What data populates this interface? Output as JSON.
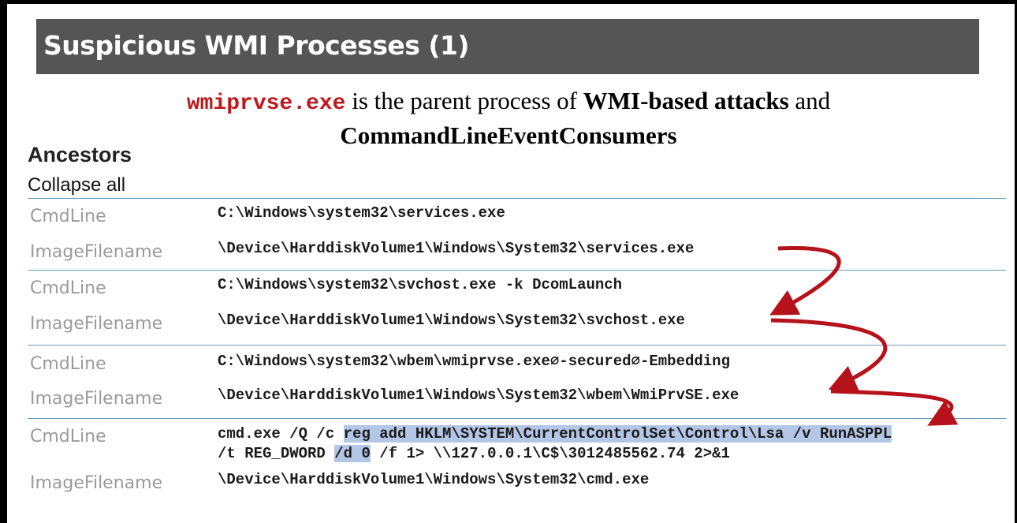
{
  "title": "Suspicious WMI Processes (1)",
  "intro": {
    "code": "wmiprvse.exe",
    "text1": " is the parent process of ",
    "bold1": "WMI-based attacks",
    "text2": " and",
    "bold2": "CommandLineEventConsumers"
  },
  "panel": {
    "heading": "Ancestors",
    "collapse_label": "Collapse all",
    "labels": {
      "cmdline": "CmdLine",
      "image": "ImageFilename"
    },
    "rows": [
      {
        "cmdline": "C:\\Windows\\system32\\services.exe",
        "image": "\\Device\\HarddiskVolume1\\Windows\\System32\\services.exe"
      },
      {
        "cmdline": "C:\\Windows\\system32\\svchost.exe -k DcomLaunch",
        "image": "\\Device\\HarddiskVolume1\\Windows\\System32\\svchost.exe"
      },
      {
        "cmdline": "C:\\Windows\\system32\\wbem\\wmiprvse.exe∅-secured∅-Embedding",
        "image": "\\Device\\HarddiskVolume1\\Windows\\System32\\wbem\\WmiPrvSE.exe"
      },
      {
        "cmdline_prefix": "cmd.exe /Q /c ",
        "cmdline_hl1": "reg add HKLM\\SYSTEM\\CurrentControlSet\\Control\\Lsa /v RunASPPL",
        "cmdline_l2_pre": "/t REG_DWORD ",
        "cmdline_hl2": "/d 0",
        "cmdline_l2_post": " /f 1> \\\\127.0.0.1\\C$\\3012485562.74 2>&1",
        "image": "\\Device\\HarddiskVolume1\\Windows\\System32\\cmd.exe"
      }
    ]
  },
  "colors": {
    "title_bg": "#555555",
    "code_red": "#c0171c",
    "arrow": "#b5121b",
    "highlight": "#b3c6e6",
    "rule": "#6a9cb8"
  }
}
